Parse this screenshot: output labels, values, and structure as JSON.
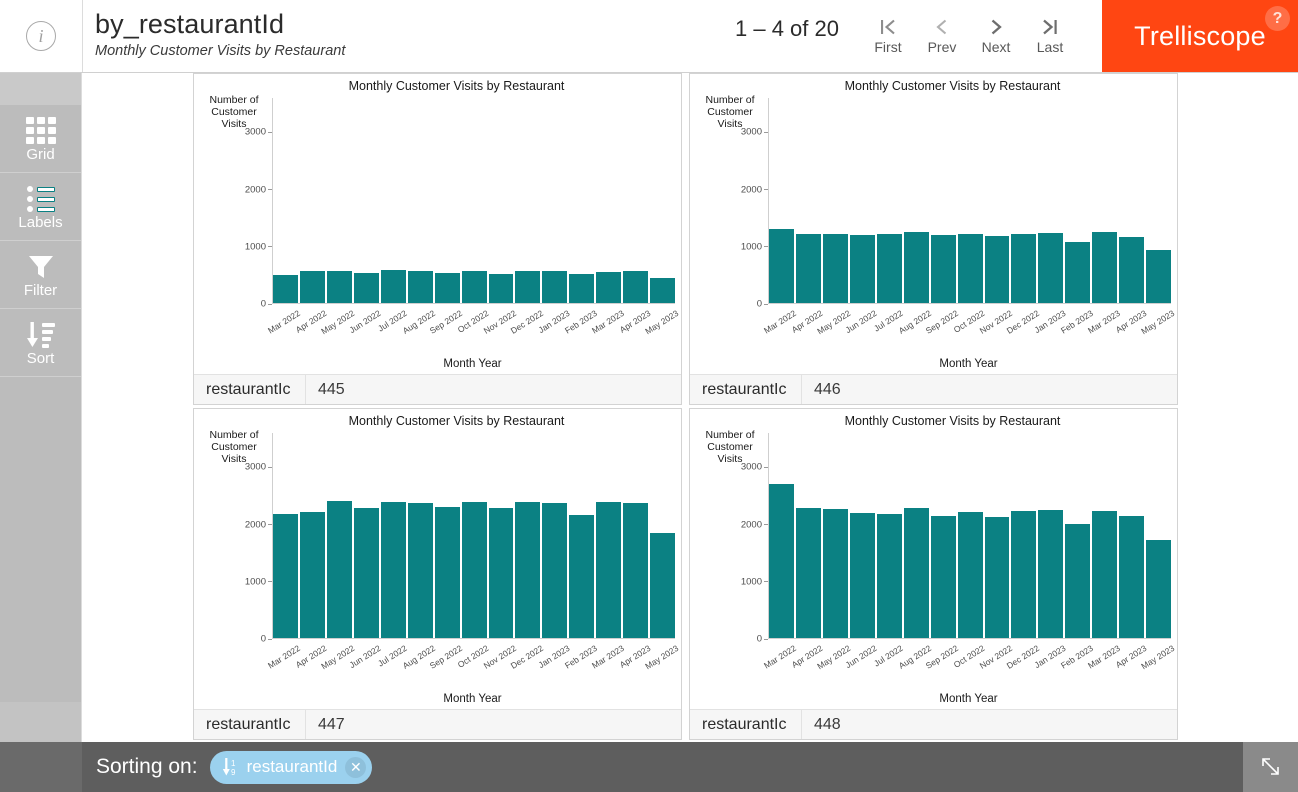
{
  "header": {
    "info_icon": "info-icon",
    "title": "by_restaurantId",
    "subtitle": "Monthly Customer Visits by Restaurant",
    "pager": {
      "count_text": "1 – 4 of 20",
      "buttons": [
        {
          "label": "First",
          "icon": "first-page-icon"
        },
        {
          "label": "Prev",
          "icon": "chevron-left-icon"
        },
        {
          "label": "Next",
          "icon": "chevron-right-icon"
        },
        {
          "label": "Last",
          "icon": "last-page-icon"
        }
      ]
    },
    "brand": "Trelliscope",
    "help_badge": "?",
    "brand_color": "#ff4612"
  },
  "sidebar": {
    "items": [
      {
        "label": "Grid",
        "icon": "grid-icon"
      },
      {
        "label": "Labels",
        "icon": "labels-icon"
      },
      {
        "label": "Filter",
        "icon": "filter-funnel-icon"
      },
      {
        "label": "Sort",
        "icon": "sort-descending-icon"
      }
    ]
  },
  "panels": [
    {
      "meta_key": "restaurantId",
      "meta_key_display": "restaurantIc",
      "meta_value": "445"
    },
    {
      "meta_key": "restaurantId",
      "meta_key_display": "restaurantIc",
      "meta_value": "446"
    },
    {
      "meta_key": "restaurantId",
      "meta_key_display": "restaurantIc",
      "meta_value": "447"
    },
    {
      "meta_key": "restaurantId",
      "meta_key_display": "restaurantIc",
      "meta_value": "448"
    }
  ],
  "footer": {
    "sorting_label": "Sorting on:",
    "chip_text": "restaurantId",
    "chip_icon": "sort-ascending-numeric-icon",
    "chip_close_icon": "close-icon",
    "chip_color": "#9bd1ee",
    "resize_icon": "resize-diagonal-icon"
  },
  "chart_data": [
    {
      "type": "bar",
      "title": "Monthly Customer Visits by Restaurant",
      "xlabel": "Month Year",
      "ylabel": "Number of Customer Visits",
      "ylim": [
        0,
        3600
      ],
      "yticks": [
        0,
        1000,
        2000,
        3000
      ],
      "grid": false,
      "legend": "none",
      "bar_color": "#0b8183",
      "panel_label": "restaurantId: 445",
      "categories": [
        "Mar 2022",
        "Apr 2022",
        "May 2022",
        "Jun 2022",
        "Jul 2022",
        "Aug 2022",
        "Sep 2022",
        "Oct 2022",
        "Nov 2022",
        "Dec 2022",
        "Jan 2023",
        "Feb 2023",
        "Mar 2023",
        "Apr 2023",
        "May 2023"
      ],
      "values": [
        500,
        555,
        560,
        535,
        585,
        565,
        535,
        565,
        515,
        565,
        570,
        515,
        545,
        560,
        440
      ]
    },
    {
      "type": "bar",
      "title": "Monthly Customer Visits by Restaurant",
      "xlabel": "Month Year",
      "ylabel": "Number of Customer Visits",
      "ylim": [
        0,
        3600
      ],
      "yticks": [
        0,
        1000,
        2000,
        3000
      ],
      "grid": false,
      "legend": "none",
      "bar_color": "#0b8183",
      "panel_label": "restaurantId: 446",
      "categories": [
        "Mar 2022",
        "Apr 2022",
        "May 2022",
        "Jun 2022",
        "Jul 2022",
        "Aug 2022",
        "Sep 2022",
        "Oct 2022",
        "Nov 2022",
        "Dec 2022",
        "Jan 2023",
        "Feb 2023",
        "Mar 2023",
        "Apr 2023",
        "May 2023"
      ],
      "values": [
        1300,
        1220,
        1210,
        1200,
        1215,
        1240,
        1200,
        1220,
        1175,
        1220,
        1235,
        1080,
        1255,
        1155,
        925
      ]
    },
    {
      "type": "bar",
      "title": "Monthly Customer Visits by Restaurant",
      "xlabel": "Month Year",
      "ylabel": "Number of Customer Visits",
      "ylim": [
        0,
        3600
      ],
      "yticks": [
        0,
        1000,
        2000,
        3000
      ],
      "grid": false,
      "legend": "none",
      "bar_color": "#0b8183",
      "panel_label": "restaurantId: 447",
      "categories": [
        "Mar 2022",
        "Apr 2022",
        "May 2022",
        "Jun 2022",
        "Jul 2022",
        "Aug 2022",
        "Sep 2022",
        "Oct 2022",
        "Nov 2022",
        "Dec 2022",
        "Jan 2023",
        "Feb 2023",
        "Mar 2023",
        "Apr 2023",
        "May 2023"
      ],
      "values": [
        2180,
        2220,
        2410,
        2280,
        2380,
        2370,
        2300,
        2380,
        2290,
        2390,
        2370,
        2155,
        2395,
        2370,
        1850
      ]
    },
    {
      "type": "bar",
      "title": "Monthly Customer Visits by Restaurant",
      "xlabel": "Month Year",
      "ylabel": "Number of Customer Visits",
      "ylim": [
        0,
        3600
      ],
      "yticks": [
        0,
        1000,
        2000,
        3000
      ],
      "grid": false,
      "legend": "none",
      "bar_color": "#0b8183",
      "panel_label": "restaurantId: 448",
      "categories": [
        "Mar 2022",
        "Apr 2022",
        "May 2022",
        "Jun 2022",
        "Jul 2022",
        "Aug 2022",
        "Sep 2022",
        "Oct 2022",
        "Nov 2022",
        "Dec 2022",
        "Jan 2023",
        "Feb 2023",
        "Mar 2023",
        "Apr 2023",
        "May 2023"
      ],
      "values": [
        2700,
        2290,
        2260,
        2200,
        2170,
        2290,
        2150,
        2215,
        2130,
        2230,
        2250,
        1995,
        2230,
        2145,
        1720
      ]
    }
  ]
}
